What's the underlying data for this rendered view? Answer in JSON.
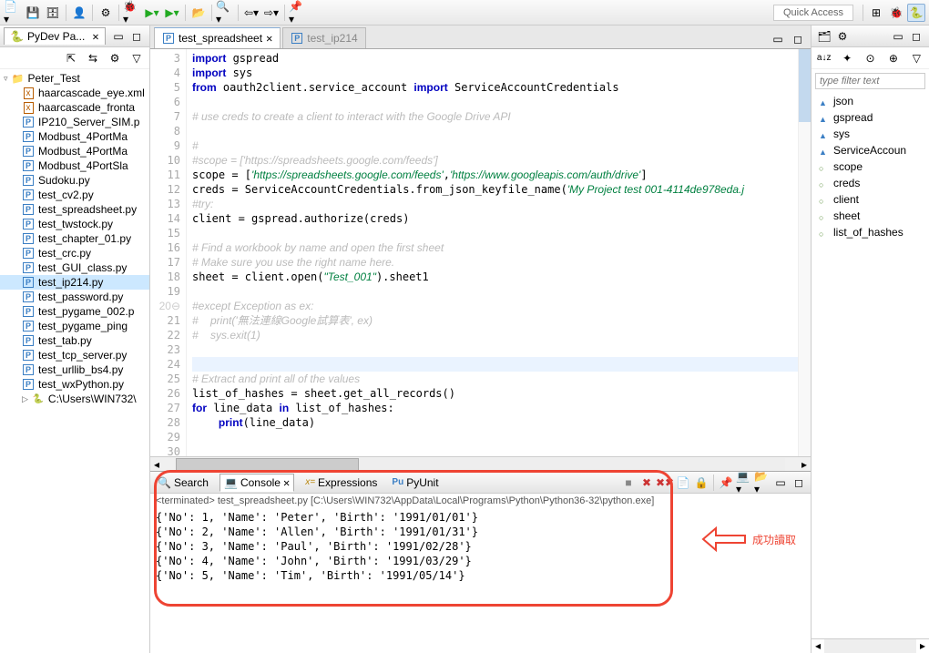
{
  "toolbar": {
    "quick_access": "Quick Access"
  },
  "left_panel": {
    "title": "PyDev Pa...",
    "project": "Peter_Test",
    "files": [
      {
        "name": "haarcascade_eye.xml",
        "icon": "xml"
      },
      {
        "name": "haarcascade_fronta",
        "icon": "xml"
      },
      {
        "name": "IP210_Server_SIM.p",
        "icon": "py"
      },
      {
        "name": "Modbust_4PortMa",
        "icon": "py"
      },
      {
        "name": "Modbust_4PortMa",
        "icon": "py"
      },
      {
        "name": "Modbust_4PortSla",
        "icon": "py"
      },
      {
        "name": "Sudoku.py",
        "icon": "py"
      },
      {
        "name": "test_cv2.py",
        "icon": "py"
      },
      {
        "name": "test_spreadsheet.py",
        "icon": "py"
      },
      {
        "name": "test_twstock.py",
        "icon": "py"
      },
      {
        "name": "test_chapter_01.py",
        "icon": "py"
      },
      {
        "name": "test_crc.py",
        "icon": "py"
      },
      {
        "name": "test_GUI_class.py",
        "icon": "py"
      },
      {
        "name": "test_ip214.py",
        "icon": "py",
        "selected": true
      },
      {
        "name": "test_password.py",
        "icon": "py"
      },
      {
        "name": "test_pygame_002.p",
        "icon": "py"
      },
      {
        "name": "test_pygame_ping",
        "icon": "py"
      },
      {
        "name": "test_tab.py",
        "icon": "py"
      },
      {
        "name": "test_tcp_server.py",
        "icon": "py"
      },
      {
        "name": "test_urllib_bs4.py",
        "icon": "py"
      },
      {
        "name": "test_wxPython.py",
        "icon": "py"
      },
      {
        "name": "C:\\Users\\WIN732\\",
        "icon": "pylib"
      }
    ]
  },
  "editor": {
    "tabs": [
      {
        "label": "test_spreadsheet",
        "active": true
      },
      {
        "label": "test_ip214",
        "active": false
      }
    ],
    "lines_start": 3,
    "lines_end": 30
  },
  "bottom": {
    "tabs": [
      {
        "label": "Search",
        "icon": "🔍"
      },
      {
        "label": "Console",
        "icon": "💻",
        "active": true
      },
      {
        "label": "Expressions",
        "icon": "xy"
      },
      {
        "label": "PyUnit",
        "icon": "Pu"
      }
    ],
    "header": "<terminated> test_spreadsheet.py [C:\\Users\\WIN732\\AppData\\Local\\Programs\\Python\\Python36-32\\python.exe]",
    "output": "{'No': 1, 'Name': 'Peter', 'Birth': '1991/01/01'}\n{'No': 2, 'Name': 'Allen', 'Birth': '1991/01/31'}\n{'No': 3, 'Name': 'Paul', 'Birth': '1991/02/28'}\n{'No': 4, 'Name': 'John', 'Birth': '1991/03/29'}\n{'No': 5, 'Name': 'Tim', 'Birth': '1991/05/14'}",
    "annotation": "成功讀取"
  },
  "outline": {
    "filter_placeholder": "type filter text",
    "items": [
      {
        "name": "json",
        "kind": "import"
      },
      {
        "name": "gspread",
        "kind": "import"
      },
      {
        "name": "sys",
        "kind": "import"
      },
      {
        "name": "ServiceAccoun",
        "kind": "import"
      },
      {
        "name": "scope",
        "kind": "var"
      },
      {
        "name": "creds",
        "kind": "var"
      },
      {
        "name": "client",
        "kind": "var"
      },
      {
        "name": "sheet",
        "kind": "var"
      },
      {
        "name": "list_of_hashes",
        "kind": "var"
      }
    ]
  }
}
